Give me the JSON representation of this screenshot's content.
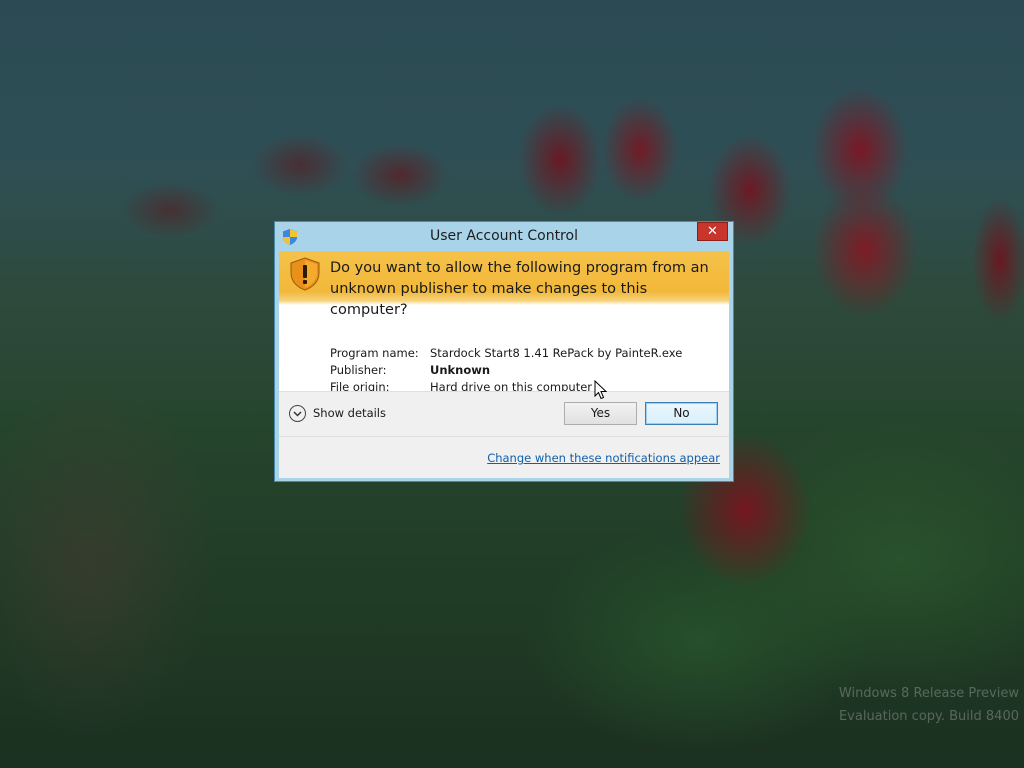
{
  "desktop": {
    "watermark_line1": "Windows 8 Release Preview",
    "watermark_line2": "Evaluation copy. Build 8400"
  },
  "dialog": {
    "title": "User Account Control",
    "close_glyph": "✕",
    "question": "Do you want to allow the following program from an unknown publisher to make changes to this computer?",
    "details": [
      {
        "label": "Program name:",
        "value": "Stardock Start8 1.41 RePack by PainteR.exe"
      },
      {
        "label": "Publisher:",
        "value": "Unknown"
      },
      {
        "label": "File origin:",
        "value": "Hard drive on this computer"
      }
    ],
    "show_details_label": "Show details",
    "yes_label": "Yes",
    "no_label": "No",
    "change_link": "Change when these notifications appear"
  },
  "colors": {
    "banner": "#f2b83a",
    "titlebar": "#a8d3e8",
    "close_button": "#c7352c",
    "link": "#0f5fad"
  },
  "icons": {
    "title": "uac-shield-icon",
    "banner": "warning-shield-icon",
    "expand": "chevron-down-icon"
  }
}
